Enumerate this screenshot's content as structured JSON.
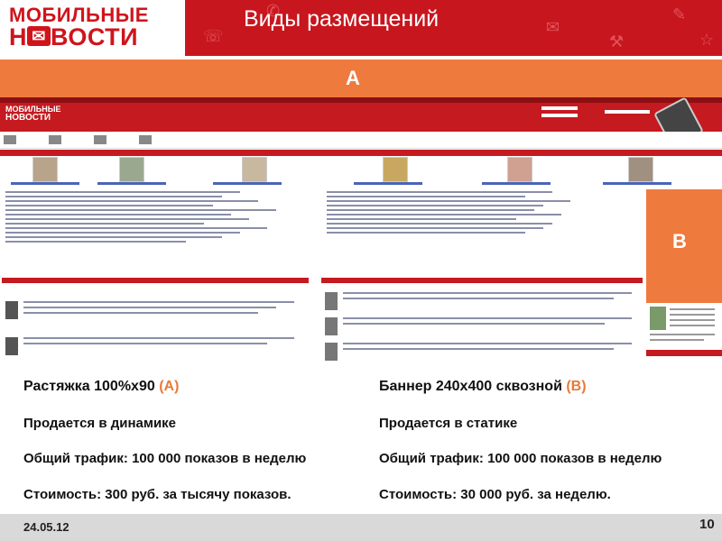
{
  "header": {
    "logo_line1": "МОБИЛЬНЫЕ",
    "logo_line2_pre": "Н",
    "logo_line2_post": "ВОСТИ",
    "title": "Виды размещений"
  },
  "placement_a": {
    "label": "A"
  },
  "placement_b": {
    "label": "B"
  },
  "left_column": {
    "title_main": "Растяжка 100%x90 ",
    "title_letter": "(A)",
    "line1": "Продается в динамике",
    "line2": "Общий трафик: 100 000 показов в неделю",
    "line3": "Стоимость: 300 руб. за тысячу показов."
  },
  "right_column": {
    "title_main": "Баннер 240x400 сквозной ",
    "title_letter": "(B)",
    "line1": "Продается в статике",
    "line2": "Общий трафик: 100 000 показов в неделю",
    "line3": "Стоимость:  30 000 руб. за неделю."
  },
  "footer": {
    "date": "24.05.12",
    "page": "10"
  },
  "colors": {
    "brand_red": "#c8161e",
    "placement_orange": "#ef7a3d",
    "footer_gray": "#d9d9d9"
  }
}
